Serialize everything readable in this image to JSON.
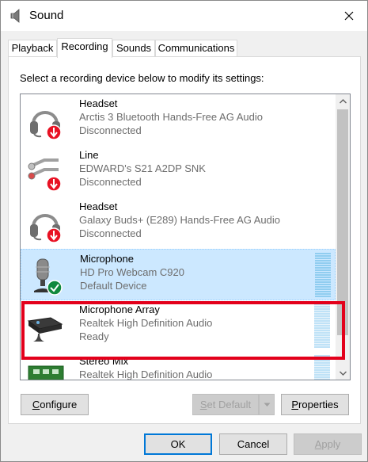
{
  "window": {
    "title": "Sound"
  },
  "tabs": [
    {
      "label": "Playback",
      "active": false
    },
    {
      "label": "Recording",
      "active": true
    },
    {
      "label": "Sounds",
      "active": false
    },
    {
      "label": "Communications",
      "active": false
    }
  ],
  "recording": {
    "instruction": "Select a recording device below to modify its settings:",
    "devices": [
      {
        "name": "Headset",
        "description": "Arctis 3 Bluetooth Hands-Free AG Audio",
        "status": "Disconnected",
        "icon": "headset-disconnected-icon",
        "selected": false
      },
      {
        "name": "Line",
        "description": "EDWARD's S21 A2DP SNK",
        "status": "Disconnected",
        "icon": "line-in-disconnected-icon",
        "selected": false
      },
      {
        "name": "Headset",
        "description": "Galaxy Buds+ (E289) Hands-Free AG Audio",
        "status": "Disconnected",
        "icon": "headset-disconnected-icon",
        "selected": false
      },
      {
        "name": "Microphone",
        "description": "HD Pro Webcam C920",
        "status": "Default Device",
        "icon": "microphone-default-icon",
        "selected": true
      },
      {
        "name": "Microphone Array",
        "description": "Realtek High Definition Audio",
        "status": "Ready",
        "icon": "microphone-array-icon",
        "selected": false
      },
      {
        "name": "Stereo Mix",
        "description": "Realtek High Definition Audio",
        "status": "",
        "icon": "stereo-mix-icon",
        "selected": false
      }
    ]
  },
  "buttons": {
    "configure": {
      "prefix": "",
      "underline": "C",
      "rest": "onfigure"
    },
    "set_default": {
      "prefix": "",
      "underline": "S",
      "rest": "et Default"
    },
    "properties": {
      "prefix": "",
      "underline": "P",
      "rest": "roperties"
    },
    "ok": "OK",
    "cancel": "Cancel",
    "apply": {
      "prefix": "",
      "underline": "A",
      "rest": "pply"
    }
  },
  "colors": {
    "accent": "#0078d7",
    "selection": "#cce8ff",
    "highlight_box": "#e3001b",
    "status_red": "#e81123",
    "status_green": "#10893e"
  }
}
